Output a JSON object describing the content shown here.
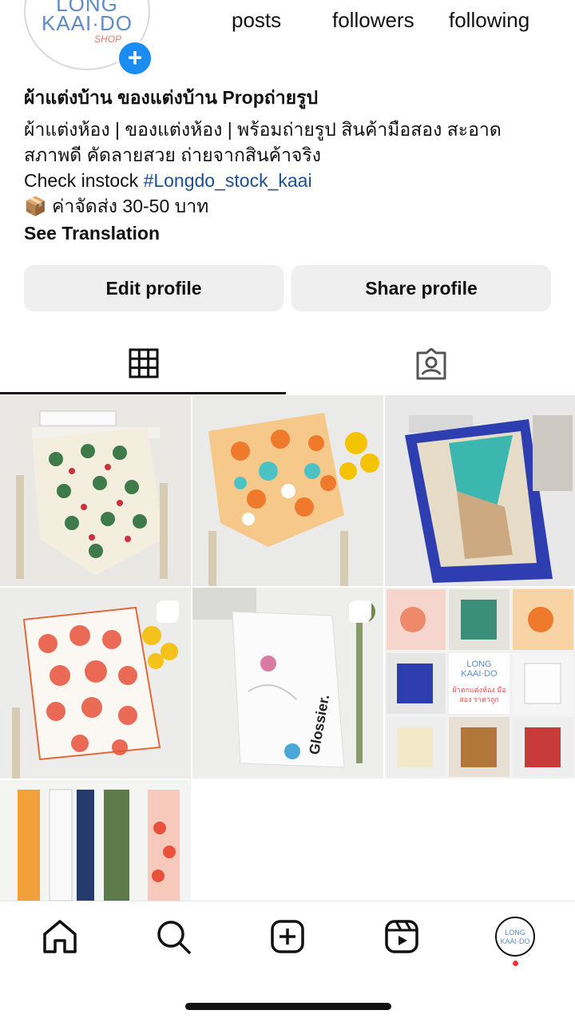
{
  "profile": {
    "avatar_text": {
      "line1": "LONG",
      "line2": "KAAI·DO",
      "line3": "SHOP"
    },
    "stats": {
      "posts_label": "posts",
      "followers_label": "followers",
      "following_label": "following"
    },
    "name": "ผ้าแต่งบ้าน ของแต่งบ้าน Propถ่ายรูป",
    "bio_line1": "ผ้าแต่งห้อง | ของแต่งห้อง | พร้อมถ่ายรูป สินค้ามือสอง สะอาด",
    "bio_line2": "สภาพดี คัดลายสวย ถ่ายจากสินค้าจริง",
    "check_text": "Check instock ",
    "hashtag": "#Longdo_stock_kaai",
    "ship_emoji": "📦",
    "ship_text": "ค่าจัดส่ง 30-50 บาท",
    "see_translation": "See Translation"
  },
  "buttons": {
    "edit_profile": "Edit profile",
    "share_profile": "Share profile"
  },
  "tabs": [
    {
      "name": "posts-grid",
      "icon": "grid-icon",
      "active": true
    },
    {
      "name": "tagged",
      "icon": "tagged-person-icon",
      "active": false
    }
  ],
  "grid": {
    "collage_logo_line1": "LONG",
    "collage_logo_line2": "KAAI·DO",
    "collage_caption": "ผ้าตกแต่งห้อง มือสอง ราคาถูก"
  },
  "nav": {
    "items": [
      "home-icon",
      "search-icon",
      "create-icon",
      "reels-icon",
      "profile-avatar"
    ],
    "profile_avatar_line1": "LONG",
    "profile_avatar_line2": "KAAI·DO",
    "notification_color": "#ff3040"
  },
  "colors": {
    "accent": "#1b8cf1",
    "hashtag": "#1d4f91",
    "button_bg": "#efefef"
  }
}
